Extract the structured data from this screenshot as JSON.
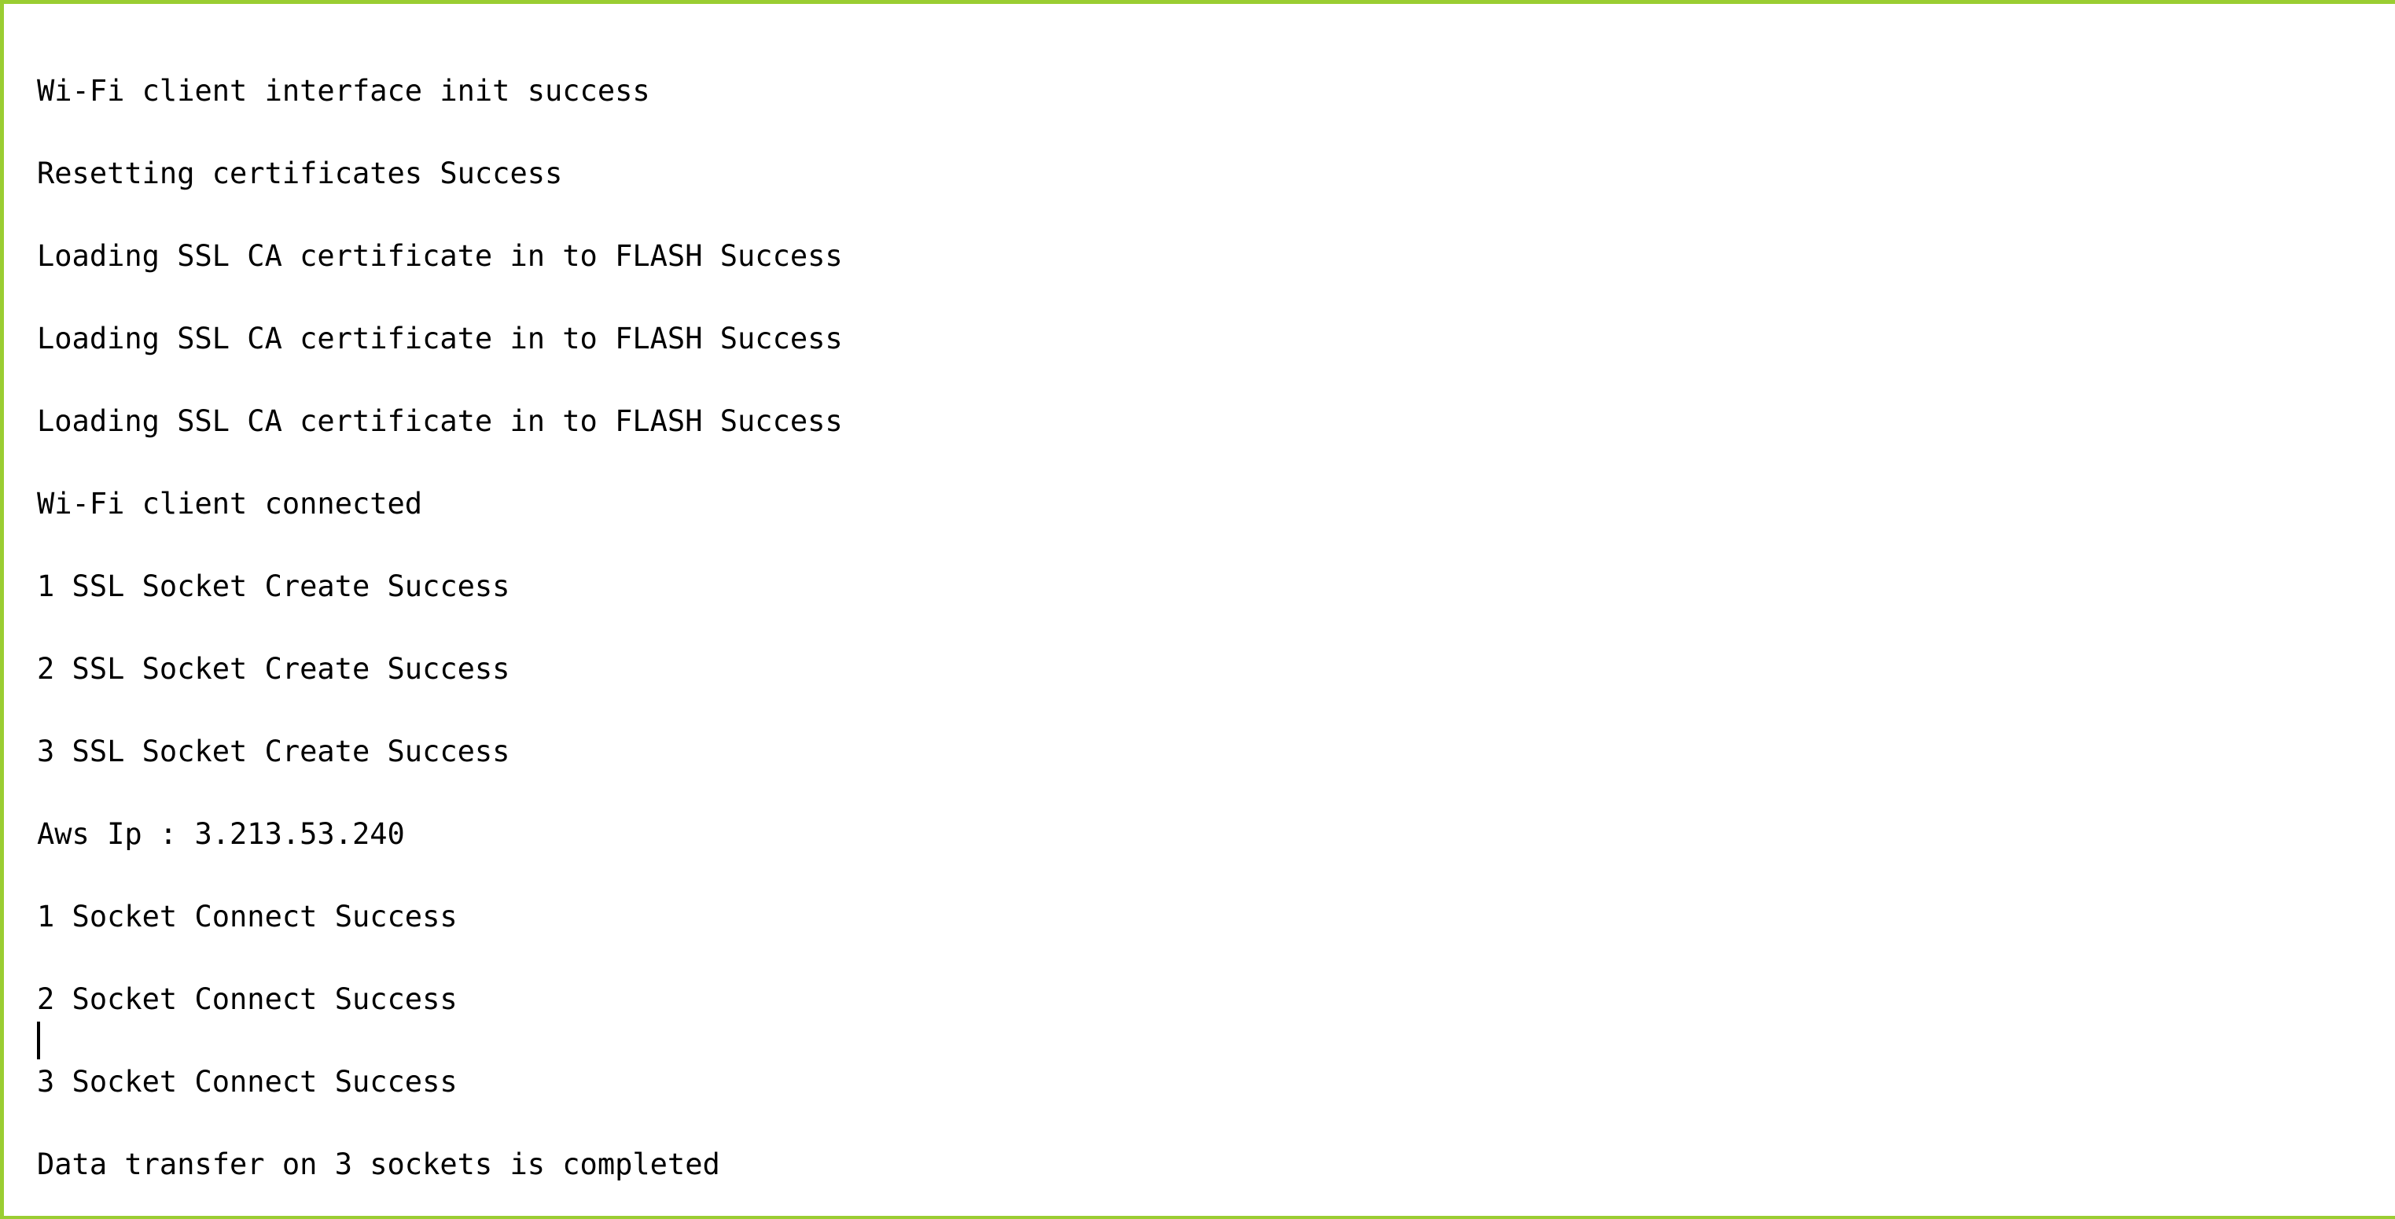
{
  "console": {
    "lines": [
      "Wi-Fi client interface init success",
      "Resetting certificates Success",
      "Loading SSL CA certificate in to FLASH Success",
      "Loading SSL CA certificate in to FLASH Success",
      "Loading SSL CA certificate in to FLASH Success",
      "Wi-Fi client connected",
      "1 SSL Socket Create Success",
      "2 SSL Socket Create Success",
      "3 SSL Socket Create Success",
      "Aws Ip : 3.213.53.240",
      "1 Socket Connect Success",
      "2 Socket Connect Success",
      "3 Socket Connect Success",
      "Data transfer on 3 sockets is completed"
    ]
  },
  "colors": {
    "border": "#9acd32",
    "text": "#000000",
    "background": "#ffffff"
  }
}
